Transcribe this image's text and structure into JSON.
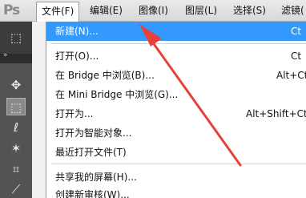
{
  "app": {
    "logo": "Ps"
  },
  "menubar": {
    "items": [
      {
        "label": "文件(F)",
        "active": true
      },
      {
        "label": "编辑(E)"
      },
      {
        "label": "图像(I)"
      },
      {
        "label": "图层(L)"
      },
      {
        "label": "选择(S)"
      },
      {
        "label": "滤镜("
      }
    ]
  },
  "file_menu": {
    "items": [
      {
        "label": "新建(N)...",
        "shortcut": "Ct"
      },
      {
        "label": "打开(O)...",
        "shortcut": "Ct"
      },
      {
        "label": "在 Bridge 中浏览(B)...",
        "shortcut": "Alt+Ct"
      },
      {
        "label": "在 Mini Bridge 中浏览(G)...",
        "shortcut": ""
      },
      {
        "label": "打开为...",
        "shortcut": "Alt+Shift+Ct"
      },
      {
        "label": "打开为智能对象...",
        "shortcut": ""
      },
      {
        "label": "最近打开文件(T)",
        "shortcut": ""
      },
      {
        "label": "共享我的屏幕(H)...",
        "shortcut": ""
      },
      {
        "label": "创建新审核(W)...",
        "shortcut": ""
      }
    ]
  },
  "tools": [
    {
      "icon": "rectangular-marquee-icon",
      "glyph": "⬚"
    },
    {
      "icon": "move-icon",
      "glyph": "✥"
    },
    {
      "icon": "marquee-icon",
      "glyph": "⬚"
    },
    {
      "icon": "lasso-icon",
      "glyph": "ℓ"
    },
    {
      "icon": "magic-wand-icon",
      "glyph": "✶"
    },
    {
      "icon": "crop-icon",
      "glyph": "⌗"
    },
    {
      "icon": "eyedropper-icon",
      "glyph": "⟋"
    }
  ],
  "colors": {
    "highlight": "#3399ff",
    "arrow": "#e8403a",
    "toolbar": "#535353"
  }
}
